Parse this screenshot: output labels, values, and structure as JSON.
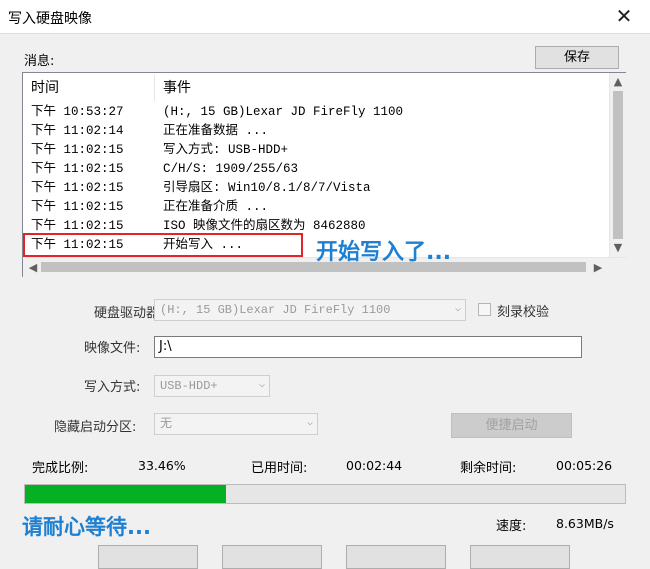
{
  "window": {
    "title": "写入硬盘映像"
  },
  "messages": {
    "label": "消息:",
    "save_label": "保存",
    "columns": {
      "time": "时间",
      "event": "事件"
    },
    "rows": [
      {
        "time": "下午 10:53:27",
        "event": "(H:, 15 GB)Lexar   JD FireFly      1100"
      },
      {
        "time": "下午 11:02:14",
        "event": "正在准备数据 ..."
      },
      {
        "time": "下午 11:02:15",
        "event": "写入方式: USB-HDD+"
      },
      {
        "time": "下午 11:02:15",
        "event": "C/H/S: 1909/255/63"
      },
      {
        "time": "下午 11:02:15",
        "event": "引导扇区: Win10/8.1/8/7/Vista"
      },
      {
        "time": "下午 11:02:15",
        "event": "正在准备介质 ..."
      },
      {
        "time": "下午 11:02:15",
        "event": "ISO 映像文件的扇区数为 8462880"
      },
      {
        "time": "下午 11:02:15",
        "event": "开始写入 ..."
      }
    ],
    "highlight_color": "#e0262b"
  },
  "annotations": {
    "writing": "开始写入了...",
    "wait": "请耐心等待...",
    "color": "#1f7fd0"
  },
  "form": {
    "drive_label": "硬盘驱动器:",
    "drive_value": "(H:, 15 GB)Lexar   JD FireFly     1100",
    "verify_label": "刻录校验",
    "verify_checked": false,
    "image_label": "映像文件:",
    "image_value": "J:\\",
    "write_mode_label": "写入方式:",
    "write_mode_value": "USB-HDD+",
    "hidden_partition_label": "隐藏启动分区:",
    "hidden_partition_value": "无",
    "quick_boot_label": "便捷启动"
  },
  "status": {
    "progress_label": "完成比例:",
    "progress_value": "33.46%",
    "progress_fraction": 0.3346,
    "elapsed_label": "已用时间:",
    "elapsed_value": "00:02:44",
    "remaining_label": "剩余时间:",
    "remaining_value": "00:05:26",
    "speed_label": "速度:",
    "speed_value": "8.63MB/s",
    "progress_color": "#06b025"
  }
}
